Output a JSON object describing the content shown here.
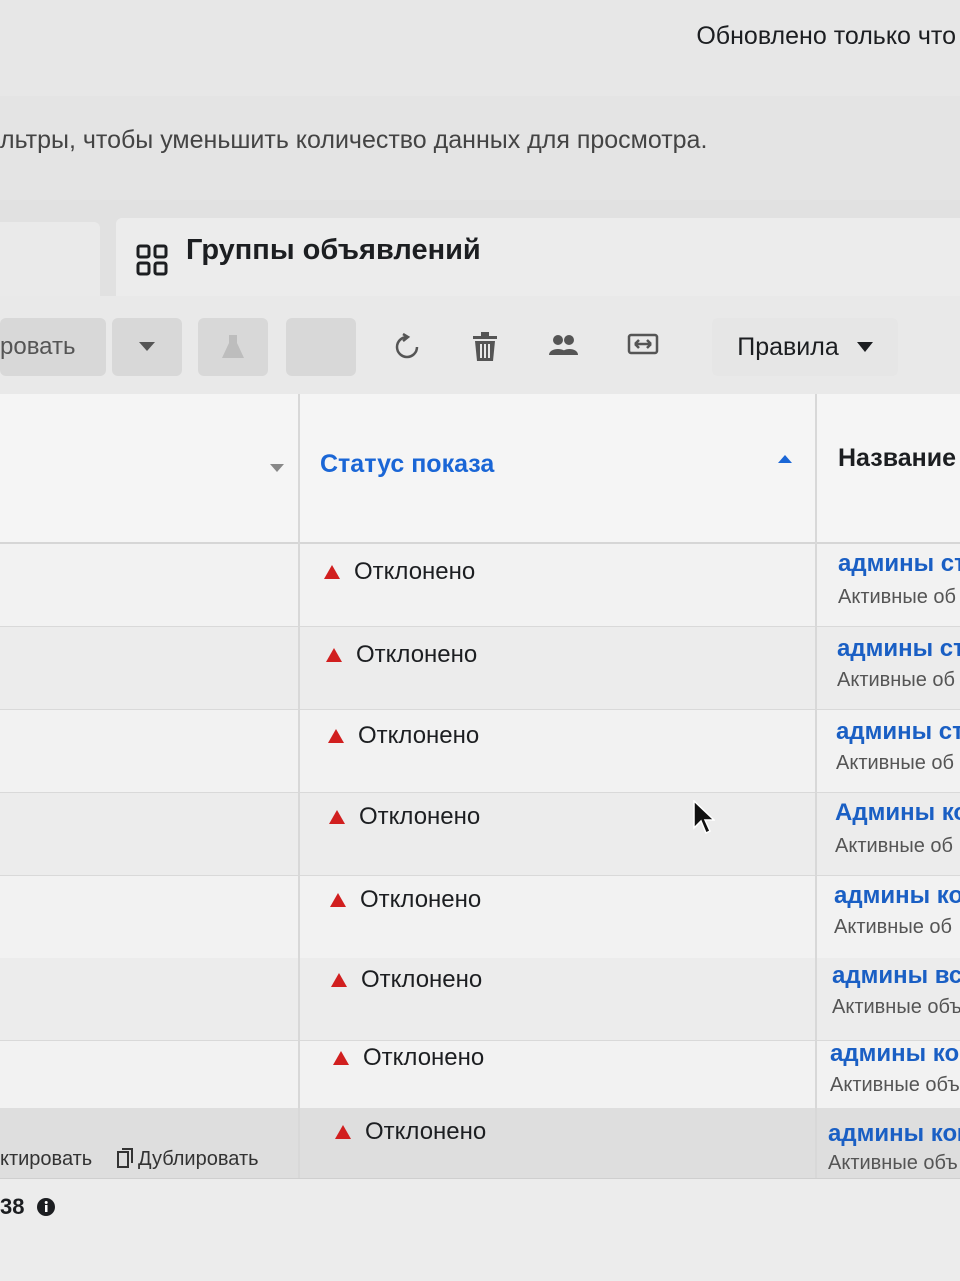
{
  "header": {
    "updated_text": "Обновлено только что"
  },
  "notice": {
    "text": "льтры, чтобы уменьшить количество данных для просмотра."
  },
  "tabs": {
    "active_label": "Группы объявлений",
    "active_icon": "grid-icon"
  },
  "toolbar": {
    "edit_partial_label": "ровать",
    "rules_label": "Правила",
    "icons": [
      "chevron-down-icon",
      "flask-icon",
      "refresh-icon",
      "trash-icon",
      "audience-icon",
      "compare-icon"
    ]
  },
  "table": {
    "columns": {
      "status": "Статус показа",
      "name": "Название"
    },
    "rows": [
      {
        "status": "Отклонено",
        "name": "админы ст",
        "sub": "Активные об"
      },
      {
        "status": "Отклонено",
        "name": "админы ст",
        "sub": "Активные об"
      },
      {
        "status": "Отклонено",
        "name": "админы ст",
        "sub": "Активные об"
      },
      {
        "status": "Отклонено",
        "name": "Админы ко",
        "sub": "Активные об"
      },
      {
        "status": "Отклонено",
        "name": "админы ко",
        "sub": "Активные об"
      },
      {
        "status": "Отклонено",
        "name": "админы все",
        "sub": "Активные объ"
      },
      {
        "status": "Отклонено",
        "name": "админы ком",
        "sub": "Активные объ"
      },
      {
        "status": "Отклонено",
        "name": "админы ком",
        "sub": "Активные объ"
      }
    ],
    "row_actions": {
      "edit": "ктировать",
      "duplicate": "Дублировать"
    }
  },
  "totals": {
    "value": "38"
  },
  "colors": {
    "link": "#1a5fc4",
    "header_link": "#1a66d6",
    "warning": "#d11f1f"
  }
}
